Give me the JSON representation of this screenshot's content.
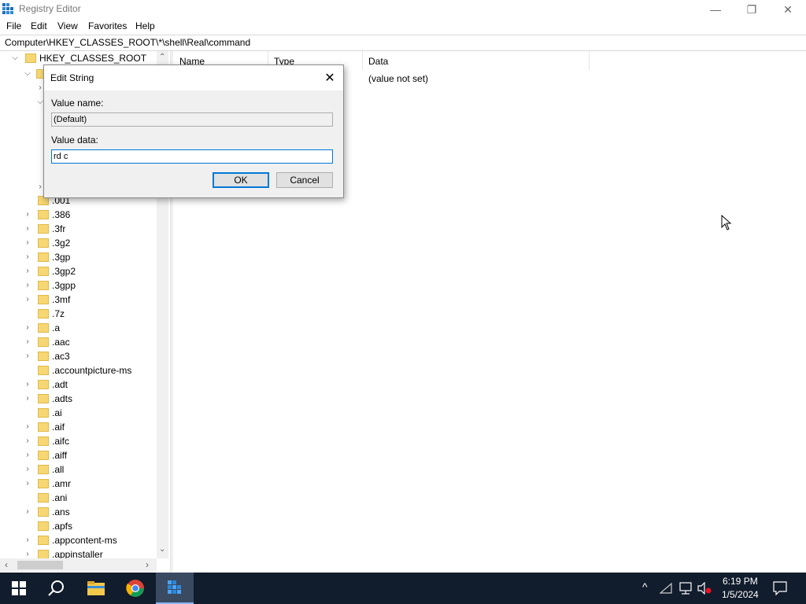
{
  "window": {
    "title": "Registry Editor",
    "minimize_glyph": "—",
    "restore_glyph": "❐",
    "close_glyph": "✕"
  },
  "menu": [
    "File",
    "Edit",
    "View",
    "Favorites",
    "Help"
  ],
  "address": "Computer\\HKEY_CLASSES_ROOT\\*\\shell\\Real\\command",
  "tree": {
    "root_label": "HKEY_CLASSES_ROOT",
    "items": [
      {
        "label": ".001",
        "expandable": false
      },
      {
        "label": ".386",
        "expandable": true
      },
      {
        "label": ".3fr",
        "expandable": true
      },
      {
        "label": ".3g2",
        "expandable": true
      },
      {
        "label": ".3gp",
        "expandable": true
      },
      {
        "label": ".3gp2",
        "expandable": true
      },
      {
        "label": ".3gpp",
        "expandable": true
      },
      {
        "label": ".3mf",
        "expandable": true
      },
      {
        "label": ".7z",
        "expandable": false
      },
      {
        "label": ".a",
        "expandable": true
      },
      {
        "label": ".aac",
        "expandable": true
      },
      {
        "label": ".ac3",
        "expandable": true
      },
      {
        "label": ".accountpicture-ms",
        "expandable": false
      },
      {
        "label": ".adt",
        "expandable": true
      },
      {
        "label": ".adts",
        "expandable": true
      },
      {
        "label": ".ai",
        "expandable": false
      },
      {
        "label": ".aif",
        "expandable": true
      },
      {
        "label": ".aifc",
        "expandable": true
      },
      {
        "label": ".aiff",
        "expandable": true
      },
      {
        "label": ".all",
        "expandable": true
      },
      {
        "label": ".amr",
        "expandable": true
      },
      {
        "label": ".ani",
        "expandable": false
      },
      {
        "label": ".ans",
        "expandable": true
      },
      {
        "label": ".apfs",
        "expandable": false
      },
      {
        "label": ".appcontent-ms",
        "expandable": true
      },
      {
        "label": ".appinstaller",
        "expandable": true
      }
    ]
  },
  "list": {
    "columns": [
      "Name",
      "Type",
      "Data"
    ],
    "row_data": "(value not set)"
  },
  "dialog": {
    "title": "Edit String",
    "value_name_label": "Value name:",
    "value_name": "(Default)",
    "value_data_label": "Value data:",
    "value_data": "rd c",
    "ok_label": "OK",
    "cancel_label": "Cancel"
  },
  "taskbar": {
    "time": "6:19 PM",
    "date": "1/5/2024"
  },
  "colors": {
    "taskbar_bg": "#111c2c",
    "accent": "#0078d7",
    "folder": "#f6d773"
  }
}
